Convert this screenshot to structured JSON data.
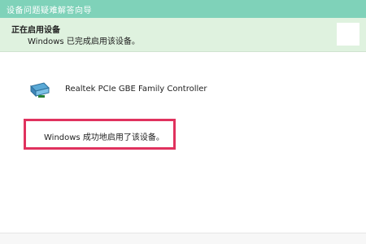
{
  "window": {
    "title": "设备问题疑难解答向导"
  },
  "header": {
    "heading": "正在启用设备",
    "subheading": "Windows 已完成启用该设备。"
  },
  "device": {
    "name": "Realtek PCIe GBE Family Controller",
    "icon": "network-adapter-icon"
  },
  "result": {
    "message": "Windows 成功地启用了该设备。",
    "highlight_color": "#e0325e"
  },
  "colors": {
    "titlebar": "#7fd2b9",
    "header_band": "#dff2df"
  }
}
